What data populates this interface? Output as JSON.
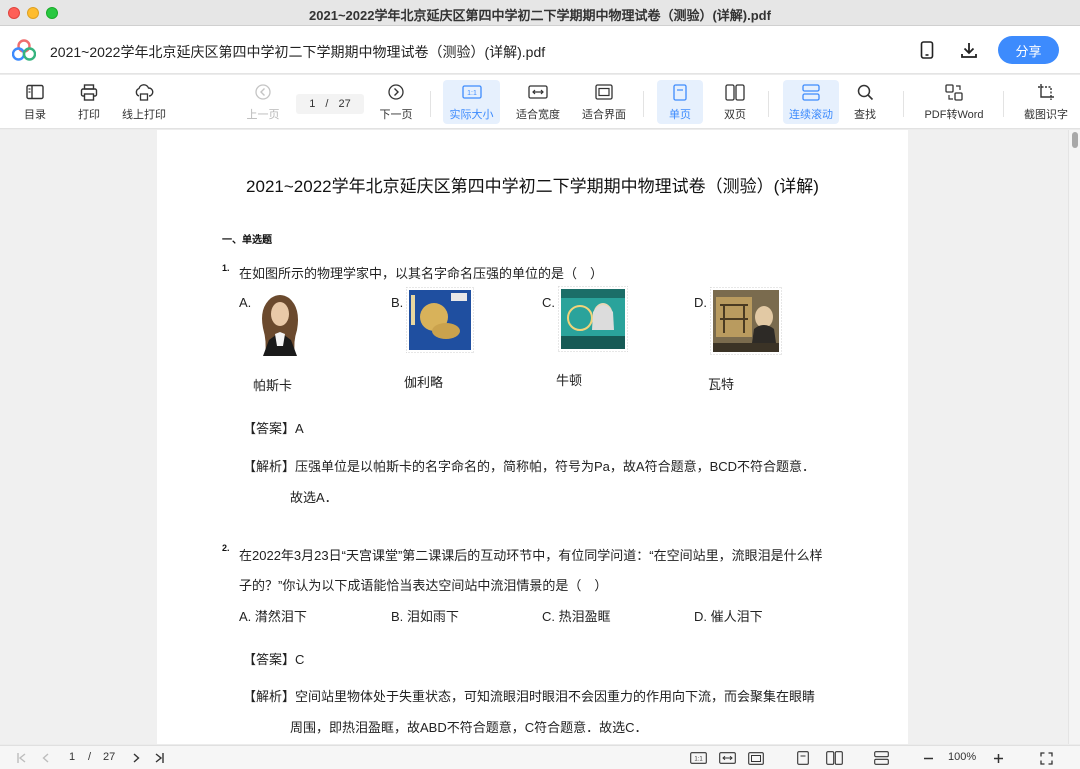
{
  "window": {
    "title": "2021~2022学年北京延庆区第四中学初二下学期期中物理试卷（测验）(详解).pdf"
  },
  "header": {
    "doc_title": "2021~2022学年北京延庆区第四中学初二下学期期中物理试卷（测验）(详解).pdf",
    "share_label": "分享"
  },
  "toolbar": {
    "toc": "目录",
    "print": "打印",
    "online_print": "线上打印",
    "prev_page": "上一页",
    "current_page": "1",
    "slash": "/",
    "total_pages": "27",
    "next_page": "下一页",
    "actual_size": "实际大小",
    "actual_size_icon_text": "1:1",
    "fit_width": "适合宽度",
    "fit_page": "适合界面",
    "single_page": "单页",
    "double_page": "双页",
    "continuous_scroll": "连续滚动",
    "find": "查找",
    "pdf_to_word": "PDF转Word",
    "ocr": "截图识字"
  },
  "document": {
    "title": "2021~2022学年北京延庆区第四中学初二下学期期中物理试卷（测验）(详解)",
    "section": "一、单选题",
    "q1": {
      "num": "1.",
      "text": "在如图所示的物理学家中，以其名字命名压强的单位的是（　）",
      "options": [
        {
          "letter": "A.",
          "caption": "帕斯卡"
        },
        {
          "letter": "B.",
          "caption": "伽利略"
        },
        {
          "letter": "C.",
          "caption": "牛顿"
        },
        {
          "letter": "D.",
          "caption": "瓦特"
        }
      ],
      "answer": "【答案】A",
      "analysis_line1": "【解析】压强单位是以帕斯卡的名字命名的，简称帕，符号为Pa，故A符合题意，BCD不符合题意．",
      "analysis_line2": "故选A．"
    },
    "q2": {
      "num": "2.",
      "text_line1": "在2022年3月23日“天宫课堂”第二课课后的互动环节中，有位同学问道：“在空间站里，流眼泪是什么样",
      "text_line2": "子的？”你认为以下成语能恰当表达空间站中流泪情景的是（　）",
      "options": [
        "A. 潸然泪下",
        "B. 泪如雨下",
        "C. 热泪盈眶",
        "D. 催人泪下"
      ],
      "answer": "【答案】C",
      "analysis_line1": "【解析】空间站里物体处于失重状态，可知流眼泪时眼泪不会因重力的作用向下流，而会聚集在眼睛",
      "analysis_line2": "周围，即热泪盈眶，故ABD不符合题意，C符合题意．故选C．"
    }
  },
  "bottombar": {
    "current_page": "1",
    "slash": "/",
    "total_pages": "27",
    "actual_size_icon_text": "1:1",
    "zoom": "100%"
  },
  "colors": {
    "accent": "#3d8bfd",
    "active_bg": "#e6f0fd"
  }
}
